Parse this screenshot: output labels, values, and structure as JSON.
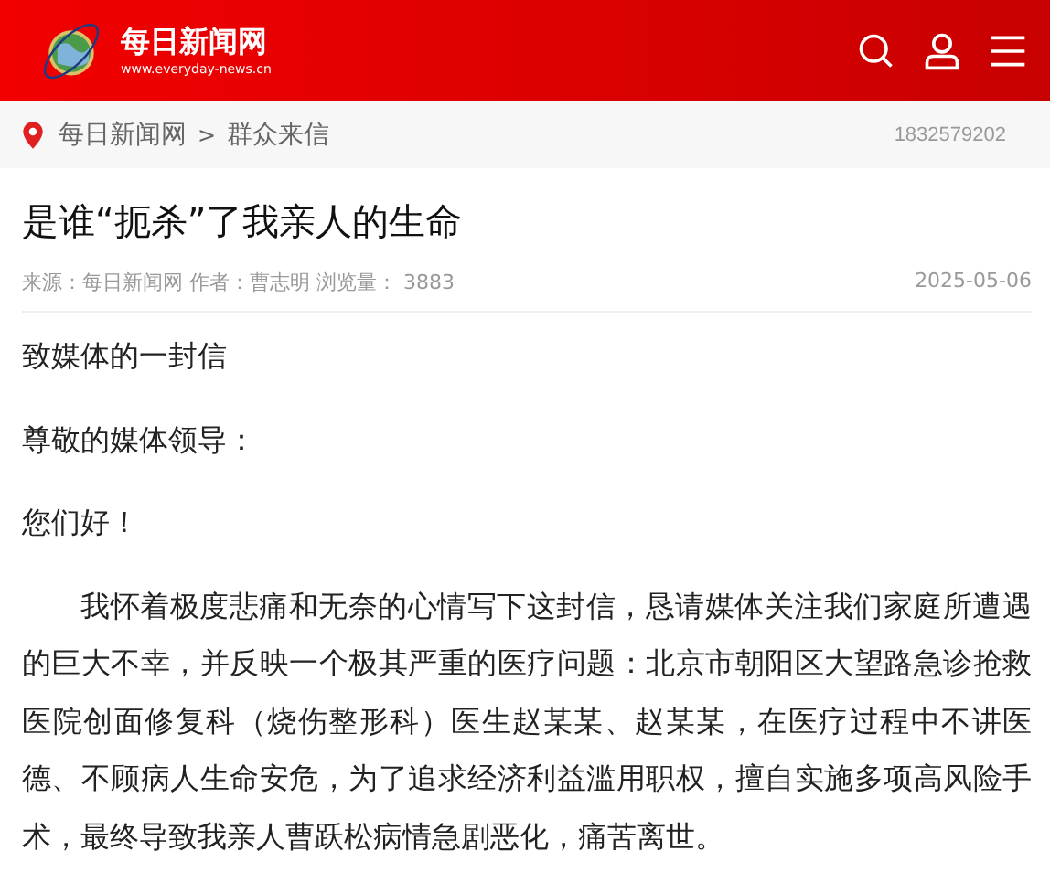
{
  "header": {
    "site_name": "每日新闻网",
    "site_url": "www.everyday-news.cn"
  },
  "breadcrumb": {
    "items": [
      "每日新闻网",
      "群众来信"
    ],
    "separator": ">",
    "phone": "1832579202"
  },
  "article": {
    "title": "是谁“扼杀”了我亲人的生命",
    "meta": "来源：每日新闻网 作者：曹志明 浏览量： 3883",
    "date": "2025-05-06",
    "paragraphs": [
      {
        "kind": "plain",
        "text": "致媒体的一封信"
      },
      {
        "kind": "plain",
        "text": "尊敬的媒体领导："
      },
      {
        "kind": "plain",
        "text": "您们好！"
      },
      {
        "kind": "indented",
        "text": "我怀着极度悲痛和无奈的心情写下这封信，恳请媒体关注我们家庭所遭遇的巨大不幸，并反映一个极其严重的医疗问题：北京市朝阳区大望路急诊抢救医院创面修复科（烧伤整形科）医生赵某某、赵某某，在医疗过程中不讲医德、不顾病人生命安危，为了追求经济利益滥用职权，擅自实施多项高风险手术，最终导致我亲人曹跃松病情急剧恶化，痛苦离世。"
      }
    ]
  }
}
